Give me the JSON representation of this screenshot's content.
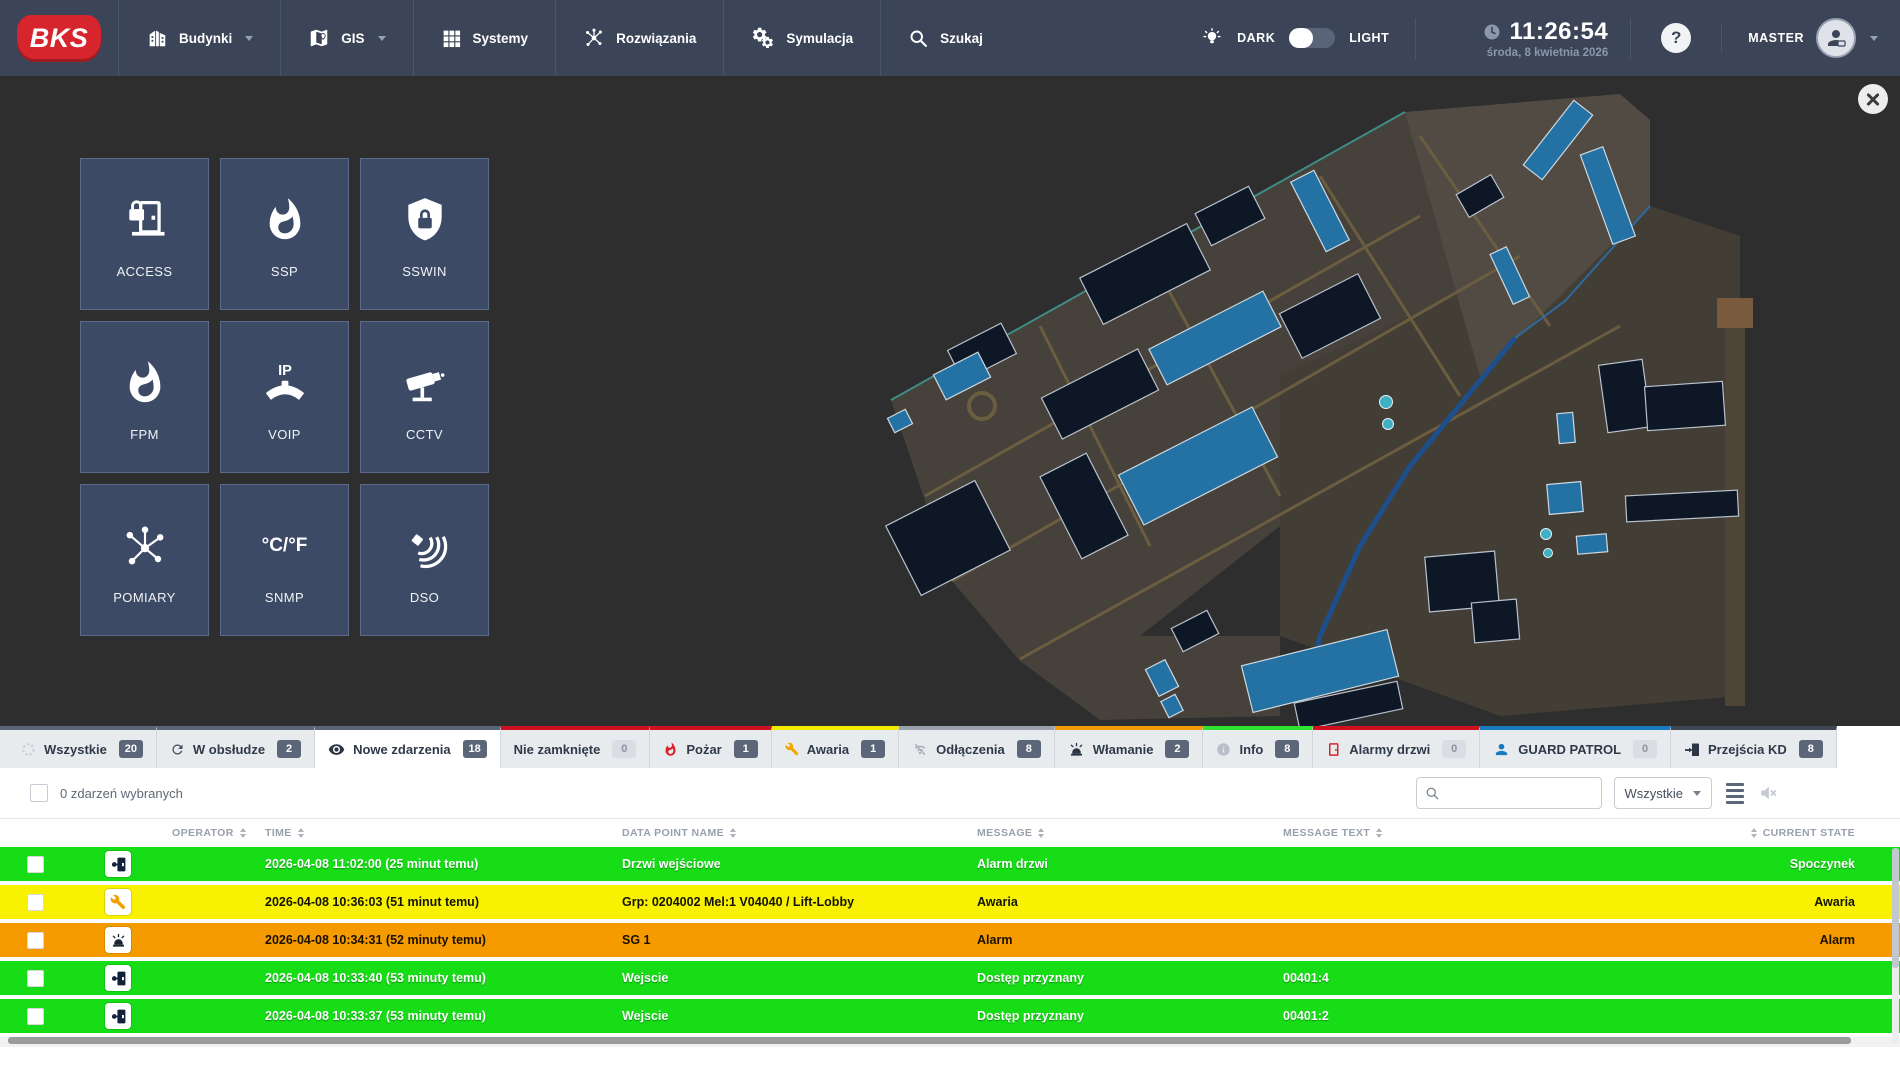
{
  "nav": {
    "logo_text": "BKS",
    "items": [
      {
        "label": "Budynki"
      },
      {
        "label": "GIS"
      },
      {
        "label": "Systemy"
      },
      {
        "label": "Rozwiązania"
      },
      {
        "label": "Symulacja"
      },
      {
        "label": "Szukaj"
      }
    ],
    "theme_toggle": {
      "dark_label": "DARK",
      "light_label": "LIGHT",
      "active": "DARK"
    },
    "clock": {
      "time": "11:26:54",
      "date": "środa, 8 kwietnia 2026"
    },
    "help_label": "?",
    "user": {
      "name": "MASTER"
    }
  },
  "overlay": {
    "tiles": [
      {
        "label": "ACCESS"
      },
      {
        "label": "SSP"
      },
      {
        "label": "SSWIN"
      },
      {
        "label": "FPM"
      },
      {
        "label": "VOIP"
      },
      {
        "label": "CCTV"
      },
      {
        "label": "POMIARY"
      },
      {
        "label": "SNMP",
        "icon_text": "°C/°F"
      },
      {
        "label": "DSO"
      }
    ]
  },
  "tabs": [
    {
      "label": "Wszystkie",
      "count": "20",
      "stripe": "#5b6577"
    },
    {
      "label": "W obsłudze",
      "count": "2",
      "stripe": "#5b6577"
    },
    {
      "label": "Nowe zdarzenia",
      "count": "18",
      "stripe": "#5b6577",
      "active": true
    },
    {
      "label": "Nie zamknięte",
      "count": "0",
      "stripe": "#cf1020"
    },
    {
      "label": "Pożar",
      "count": "1",
      "stripe": "#cf1020"
    },
    {
      "label": "Awaria",
      "count": "1",
      "stripe": "#f2ea00"
    },
    {
      "label": "Odłączenia",
      "count": "8",
      "stripe": "#9aa1aa"
    },
    {
      "label": "Włamanie",
      "count": "2",
      "stripe": "#f29a00"
    },
    {
      "label": "Info",
      "count": "8",
      "stripe": "#2ee42e"
    },
    {
      "label": "Alarmy drzwi",
      "count": "0",
      "stripe": "#cf1020"
    },
    {
      "label": "GUARD PATROL",
      "count": "0",
      "stripe": "#1a7ac0"
    },
    {
      "label": "Przejścia KD",
      "count": "8",
      "stripe": "#3f4756"
    }
  ],
  "filter_bar": {
    "selection_label": "0 zdarzeń wybranych",
    "filter_value": "Wszystkie"
  },
  "table": {
    "columns": [
      "OPERATOR",
      "TIME",
      "DATA POINT NAME",
      "MESSAGE",
      "MESSAGE TEXT",
      "CURRENT STATE"
    ],
    "rows": [
      {
        "status_color": "green",
        "time": "2026-04-08 11:02:00 (25 minut temu)",
        "data_point": "Drzwi wejściowe",
        "message": "Alarm drzwi",
        "message_text": "",
        "current_state": "Spoczynek"
      },
      {
        "status_color": "yellow",
        "time": "2026-04-08 10:36:03 (51 minut temu)",
        "data_point": "Grp: 0204002 Mel:1 V04040 / Lift-Lobby",
        "message": "Awaria",
        "message_text": "",
        "current_state": "Awaria"
      },
      {
        "status_color": "orange",
        "time": "2026-04-08 10:34:31 (52 minuty temu)",
        "data_point": "SG 1",
        "message": "Alarm",
        "message_text": "",
        "current_state": "Alarm"
      },
      {
        "status_color": "green",
        "time": "2026-04-08 10:33:40 (53 minuty temu)",
        "data_point": "Wejscie",
        "message": "Dostęp przyznany",
        "message_text": "00401:4",
        "current_state": ""
      },
      {
        "status_color": "green",
        "time": "2026-04-08 10:33:37 (53 minuty temu)",
        "data_point": "Wejscie",
        "message": "Dostęp przyznany",
        "message_text": "00401:2",
        "current_state": ""
      }
    ]
  },
  "colors": {
    "brand_red": "#d6252c",
    "nav_bg": "#3b4557",
    "tile_bg": "#3d4a66",
    "row_green": "#16dd16",
    "row_yellow": "#f8f200",
    "row_orange": "#f59b00",
    "map_highlight_blue": "#2471a3",
    "map_building_navy": "#0d1726",
    "map_terrain": "#46413a"
  }
}
